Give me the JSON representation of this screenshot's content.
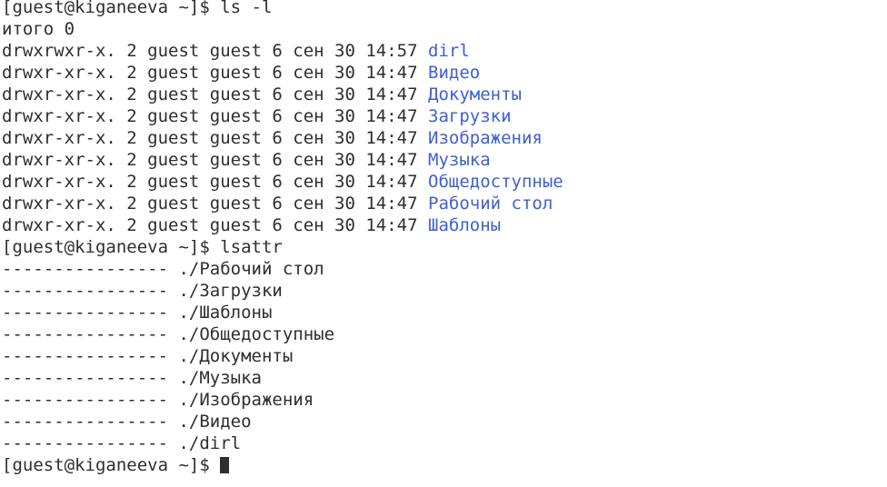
{
  "terminal": {
    "prompt_ls": "[guest@kiganeeva ~]$ ls -l",
    "total": "итого 0",
    "ls_entries": [
      {
        "meta": "drwxrwxr-x. 2 guest guest 6 сен 30 14:57 ",
        "name": "dirl"
      },
      {
        "meta": "drwxr-xr-x. 2 guest guest 6 сен 30 14:47 ",
        "name": "Видео"
      },
      {
        "meta": "drwxr-xr-x. 2 guest guest 6 сен 30 14:47 ",
        "name": "Документы"
      },
      {
        "meta": "drwxr-xr-x. 2 guest guest 6 сен 30 14:47 ",
        "name": "Загрузки"
      },
      {
        "meta": "drwxr-xr-x. 2 guest guest 6 сен 30 14:47 ",
        "name": "Изображения"
      },
      {
        "meta": "drwxr-xr-x. 2 guest guest 6 сен 30 14:47 ",
        "name": "Музыка"
      },
      {
        "meta": "drwxr-xr-x. 2 guest guest 6 сен 30 14:47 ",
        "name": "Общедоступные"
      },
      {
        "meta": "drwxr-xr-x. 2 guest guest 6 сен 30 14:47 ",
        "name": "Рабочий стол"
      },
      {
        "meta": "drwxr-xr-x. 2 guest guest 6 сен 30 14:47 ",
        "name": "Шаблоны"
      }
    ],
    "prompt_lsattr": "[guest@kiganeeva ~]$ lsattr",
    "lsattr_entries": [
      "---------------- ./Рабочий стол",
      "---------------- ./Загрузки",
      "---------------- ./Шаблоны",
      "---------------- ./Общедоступные",
      "---------------- ./Документы",
      "---------------- ./Музыка",
      "---------------- ./Изображения",
      "---------------- ./Видео",
      "---------------- ./dirl"
    ],
    "prompt_final": "[guest@kiganeeva ~]$ ",
    "colors": {
      "text": "#2e2e2e",
      "directory": "#3f5fd6",
      "background": "#ffffff"
    }
  }
}
